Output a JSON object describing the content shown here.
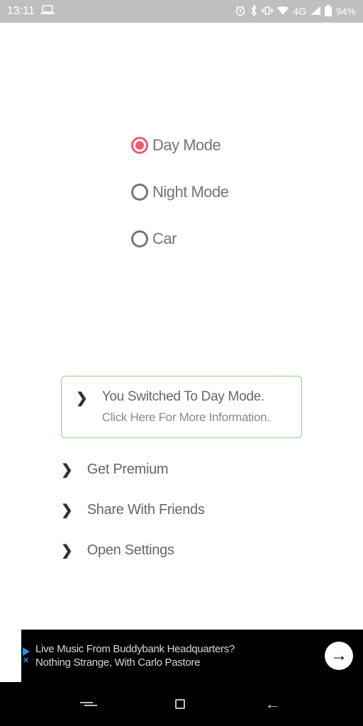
{
  "status": {
    "time": "13:11",
    "network": "4G",
    "battery": "94%"
  },
  "modes": {
    "items": [
      {
        "label": "Day Mode",
        "selected": true
      },
      {
        "label": "Night Mode",
        "selected": false
      },
      {
        "label": "Car",
        "selected": false
      }
    ]
  },
  "highlight": {
    "title": "You Switched To Day Mode.",
    "sub": "Click Here For More Information."
  },
  "actions": [
    {
      "label": "Get Premium"
    },
    {
      "label": "Share With Friends"
    },
    {
      "label": "Open Settings"
    }
  ],
  "ad": {
    "line1": "Live Music From Buddybank Headquarters?",
    "line2": "Nothing Strange, With Carlo Pastore"
  }
}
